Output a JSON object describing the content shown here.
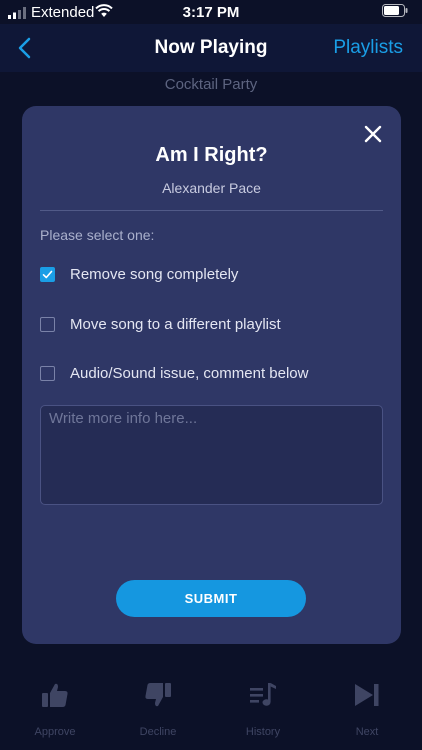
{
  "status_bar": {
    "carrier": "Extended",
    "time": "3:17 PM"
  },
  "nav": {
    "title": "Now Playing",
    "right_link": "Playlists"
  },
  "subtitle": "Cocktail Party",
  "modal": {
    "title": "Am I Right?",
    "artist": "Alexander Pace",
    "prompt": "Please select one:",
    "options": [
      {
        "label": "Remove song completely",
        "checked": true
      },
      {
        "label": "Move song to a different playlist",
        "checked": false
      },
      {
        "label": "Audio/Sound issue, comment below",
        "checked": false
      }
    ],
    "comment_placeholder": "Write more info here...",
    "comment_value": "",
    "submit_label": "SUBMIT"
  },
  "tabs": [
    {
      "label": "Approve",
      "icon": "thumbs-up-icon"
    },
    {
      "label": "Decline",
      "icon": "thumbs-down-icon"
    },
    {
      "label": "History",
      "icon": "music-list-icon"
    },
    {
      "label": "Next",
      "icon": "skip-next-icon"
    }
  ],
  "colors": {
    "background": "#0c1128",
    "modal": "#2f3766",
    "accent": "#1a9ee6",
    "tab_inactive": "#3f4563"
  }
}
